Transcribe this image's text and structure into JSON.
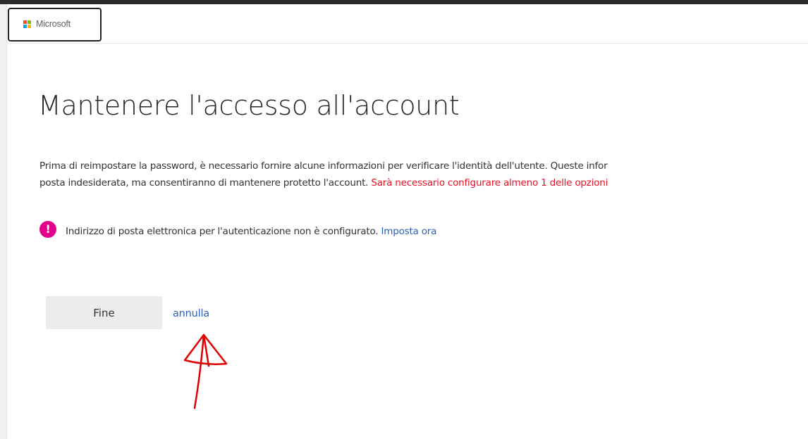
{
  "header": {
    "brand_name": "Microsoft"
  },
  "page": {
    "title": "Mantenere l'accesso all'account",
    "description_line1": "Prima di reimpostare la password, è necessario fornire alcune informazioni per verificare l'identità dell'utente. Queste infor",
    "description_line2": "posta indesiderata, ma consentiranno di mantenere protetto l'account. ",
    "description_line2_warning": "Sarà necessario configurare almeno 1 delle opzioni"
  },
  "notice": {
    "icon": "exclamation-icon",
    "icon_glyph": "!",
    "text": "Indirizzo di posta elettronica per l'autenticazione non è configurato. ",
    "link_label": "Imposta ora"
  },
  "actions": {
    "finish_label": "Fine",
    "cancel_label": "annulla"
  },
  "colors": {
    "warning": "#e81123",
    "link": "#2e5fba",
    "alert_icon": "#e3008c",
    "annotation": "#e00000"
  }
}
